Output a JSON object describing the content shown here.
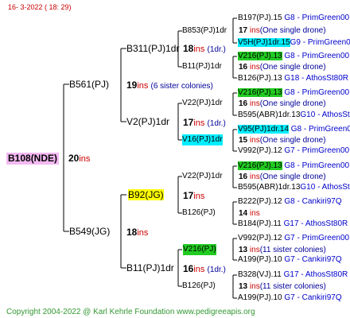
{
  "header": "16-  3-2022 ( 18: 29)",
  "footer": "Copyright 2004-2022 @ Karl Kehrle Foundation    www.pedigreeapis.org",
  "root": {
    "id": "B108(NDE)",
    "ins": "20",
    "ins_unit": "ins"
  },
  "gen1": [
    {
      "id": "B561(PJ)",
      "ins": "19",
      "ins_unit": "ins",
      "note": "(6 sister colonies)"
    },
    {
      "id": "B549(JG)",
      "ins": "18",
      "ins_unit": "ins"
    }
  ],
  "gen2": [
    {
      "id": "B311(PJ)1dr",
      "ins": "18",
      "ins_unit": "ins",
      "note": "(1dr.)"
    },
    {
      "id": "V2(PJ)1dr",
      "ins": "17",
      "ins_unit": "ins",
      "note": "(1dr.)"
    },
    {
      "id": "B92(JG)",
      "ins": "17",
      "ins_unit": "ins"
    },
    {
      "id": "B11(PJ)1dr",
      "ins": "16",
      "ins_unit": "ins",
      "note": "(1dr.)"
    }
  ],
  "gen3": [
    {
      "id": "B853(PJ)1dr",
      "ins": "17",
      "ins_unit": "ins",
      "note": "(One single drone)"
    },
    {
      "id": "B11(PJ)1dr",
      "ins": "16",
      "ins_unit": "ins",
      "note": "(One single drone)"
    },
    {
      "id": "V22(PJ)1dr",
      "ins": "16",
      "ins_unit": "ins",
      "note": "(One single drone)"
    },
    {
      "id": "V16(PJ)1dr",
      "ins": "15",
      "ins_unit": "ins",
      "note": "(One single drone)"
    },
    {
      "id": "V22(PJ)1dr",
      "ins": "16",
      "ins_unit": "ins",
      "note": "(One single drone)"
    },
    {
      "id": "B126(PJ)",
      "ins": "14",
      "ins_unit": "ins"
    },
    {
      "id": "V216(PJ)",
      "ins": "13",
      "ins_unit": "ins",
      "note": "(11 sister colonies)"
    },
    {
      "id": "B126(PJ)",
      "ins": "13",
      "ins_unit": "ins",
      "note": "(11 sister colonies)"
    }
  ],
  "gen4": [
    {
      "id": "B197(PJ).15",
      "origin": "G8 - PrimGreen00"
    },
    {
      "id": "V5H(PJ)1dr.15",
      "origin": "G9 - PrimGreen00"
    },
    {
      "id": "V216(PJ).13",
      "origin": "G8 - PrimGreen00"
    },
    {
      "id": "B126(PJ).13",
      "origin": "G18 - AthosSt80R"
    },
    {
      "id": "V216(PJ).13",
      "origin": "G8 - PrimGreen00"
    },
    {
      "id": "B595(ABR)1dr.13",
      "origin": "G10 - AthosSt80R"
    },
    {
      "id": "V95(PJ)1dr.14",
      "origin": "G8 - PrimGreen00"
    },
    {
      "id": "V992(PJ).12",
      "origin": "G7 - PrimGreen00"
    },
    {
      "id": "V216(PJ).13",
      "origin": "G8 - PrimGreen00"
    },
    {
      "id": "B595(ABR)1dr.13",
      "origin": "G10 - AthosSt80R"
    },
    {
      "id": "B222(PJ).12",
      "origin": "G8 - Cankiri97Q"
    },
    {
      "id": "B184(PJ).11",
      "origin": "G17 - AthosSt80R"
    },
    {
      "id": "V992(PJ).12",
      "origin": "G7 - PrimGreen00"
    },
    {
      "id": "A199(PJ).10",
      "origin": "G7 - Cankiri97Q"
    },
    {
      "id": "B328(VJ).11",
      "origin": "G17 - AthosSt80R"
    },
    {
      "id": "A199(PJ).10",
      "origin": "G7 - Cankiri97Q"
    }
  ]
}
